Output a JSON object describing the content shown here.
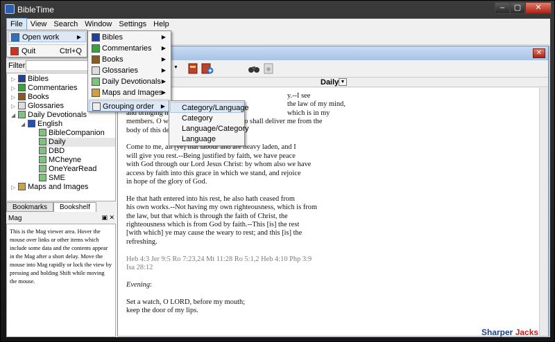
{
  "window": {
    "title": "BibleTime",
    "minimize": "–",
    "maximize": "▢",
    "close": "✕"
  },
  "menubar": [
    "File",
    "View",
    "Search",
    "Window",
    "Settings",
    "Help"
  ],
  "file_menu": {
    "open_work": "Open work",
    "quit": "Quit",
    "quit_shortcut": "Ctrl+Q"
  },
  "open_work_menu": [
    "Bibles",
    "Commentaries",
    "Books",
    "Glossaries",
    "Daily Devotionals",
    "Maps and Images",
    "Grouping order"
  ],
  "grouping_menu": [
    "Category/Language",
    "Category",
    "Language/Category",
    "Language"
  ],
  "filter_label": "Filter:",
  "tree": {
    "bibles": "Bibles",
    "commentaries": "Commentaries",
    "books": "Books",
    "glossaries": "Glossaries",
    "devotionals": "Daily Devotionals",
    "english": "English",
    "items": [
      "BibleCompanion",
      "Daily",
      "DBD",
      "MCheyne",
      "OneYearRead",
      "SME"
    ],
    "maps": "Maps and Images"
  },
  "tabs": {
    "bookmarks": "Bookmarks",
    "bookshelf": "Bookshelf"
  },
  "mag": {
    "title": "Mag",
    "controls": "▣ ✕",
    "text": "This is the Mag viewer area. Hover the mouse over links or other items which include some data and the contents appear in the Mag after a short delay. Move the mouse into Mag rapidly or lock the view by pressing and holding Shift while moving the mouse."
  },
  "doc": {
    "close": "✕",
    "module": "Daily",
    "para1": "They . . . weary\nanother law in m\nand bringing me\nmembers. O wretched man that I am! who shall deliver me from the\nbody of this death?",
    "para1_tail": "y.--I see\nthe law of my mind,\nwhich is in my",
    "para2": "Come to me, all [ye] that labour and are heavy laden, and I\nwill give you rest.--Being justified by faith, we have peace\nwith God through our Lord Jesus Christ: by whom also we have\naccess by faith into this grace in which we stand, and rejoice\nin hope of the glory of God.",
    "para3": "He that hath entered into his rest, he also hath ceased from\nhis own works.--Not having my own righteousness, which is from\nthe law, but that which is through the faith of Christ, the\nrighteousness which is from God by faith.--This [is] the rest\n[with which] ye may cause the weary to rest; and this [is] the\nrefreshing.",
    "refs": "Heb 4:3 Jer 9:5 Ro 7:23,24 Mt 11:28 Ro 5:1,2 Heb 4:10 Php 3:9\nIsa 28:12",
    "evening": "Evening",
    "evening_colon": ":",
    "para4": "Set a watch, O LORD, before my mouth;\nkeep the door of my lips."
  },
  "watermark": {
    "part1": "Sharper ",
    "part2": "Jacks"
  }
}
